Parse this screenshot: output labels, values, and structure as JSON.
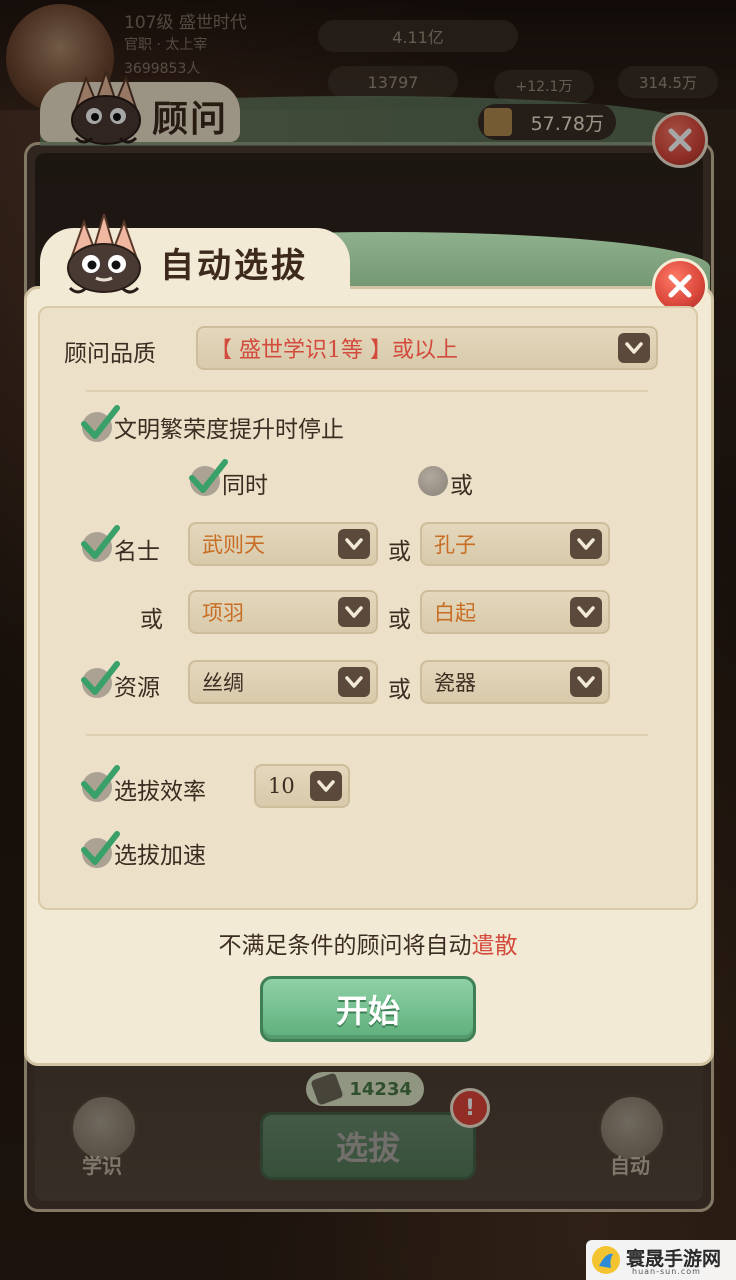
{
  "top_bar": {
    "level_title": "107级 盛世时代",
    "subtitle": "官职 · 太上宰",
    "population": "3699853人",
    "currency": "4.11亿",
    "stat_a": "13797",
    "stat_b": "+12.1万",
    "stat_c": "314.5万"
  },
  "advisor_panel": {
    "title": "顾问",
    "count": "57.78万",
    "cost": "14234",
    "select_button": "选拔",
    "left_button": "学识",
    "right_button": "自动",
    "notice_badge": "!"
  },
  "dialog": {
    "title": "自动选拔",
    "quality_label": "顾问品质",
    "quality_value": "【 盛世学识1等 】或以上",
    "stop_on_prosperity": "文明繁荣度提升时停止",
    "mode_same_time": "同时",
    "mode_or": "或",
    "famous_label": "名士",
    "famous_1": "武则天",
    "famous_2": "孔子",
    "famous_3": "项羽",
    "famous_4": "白起",
    "or": "或",
    "resource_label": "资源",
    "resource_1": "丝绸",
    "resource_2": "瓷器",
    "efficiency_label": "选拔效率",
    "efficiency_value": "10",
    "accelerate_label": "选拔加速",
    "footer_prefix": "不满足条件的顾问将自动",
    "footer_highlight": "遣散",
    "start_button": "开始"
  },
  "watermark": {
    "name": "寰晟手游网",
    "url": "huan-sun.com"
  },
  "colors": {
    "accent_green": "#5eaf7b",
    "highlight_red": "#d24b3d",
    "value_orange": "#c86d24",
    "panel_cream": "#f3ead6"
  },
  "icons": [
    "close-icon",
    "chevron-down-icon",
    "checkmark-icon",
    "mascot-icon",
    "scroll-icon",
    "book-icon",
    "refresh-icon"
  ]
}
